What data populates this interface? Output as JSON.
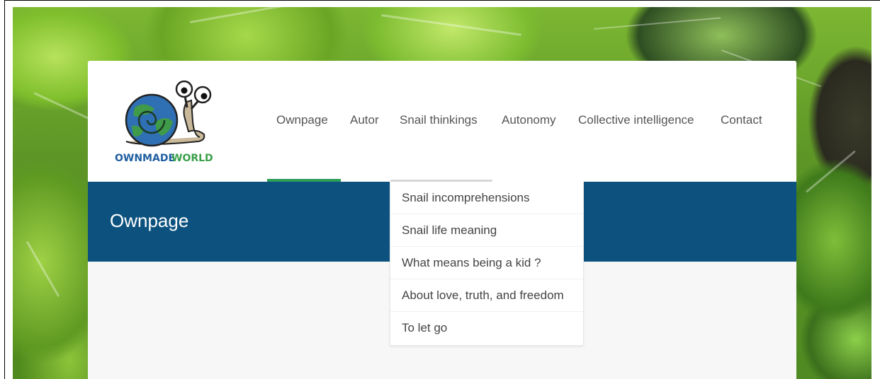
{
  "site": {
    "logo_text": "OWNMADE WORLD"
  },
  "nav": {
    "items": [
      {
        "label": "Ownpage"
      },
      {
        "label": "Autor"
      },
      {
        "label": "Snail thinkings"
      },
      {
        "label": "Autonomy"
      },
      {
        "label": "Collective intelligence"
      },
      {
        "label": "Contact"
      }
    ],
    "active": "Ownpage"
  },
  "banner": {
    "title": "Ownpage"
  },
  "dropdown": {
    "parent": "Snail thinkings",
    "items": [
      {
        "label": "Snail incomprehensions"
      },
      {
        "label": "Snail life meaning"
      },
      {
        "label": "What means being a kid ?"
      },
      {
        "label": "About love, truth, and freedom"
      },
      {
        "label": "To let go"
      }
    ]
  },
  "colors": {
    "banner": "#0d527f",
    "active_underline": "#2e9e59",
    "nav_text": "#555555"
  }
}
